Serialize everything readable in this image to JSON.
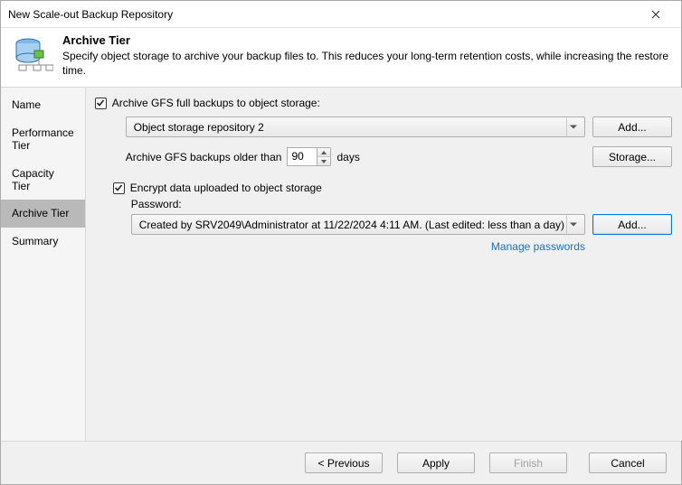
{
  "window": {
    "title": "New Scale-out Backup Repository"
  },
  "header": {
    "title": "Archive Tier",
    "subtitle": "Specify object storage to archive your backup files to. This reduces your long-term retention costs, while increasing the restore time."
  },
  "sidebar": {
    "items": [
      {
        "label": "Name"
      },
      {
        "label": "Performance Tier"
      },
      {
        "label": "Capacity Tier"
      },
      {
        "label": "Archive Tier"
      },
      {
        "label": "Summary"
      }
    ],
    "selected_index": 3
  },
  "content": {
    "archive_checkbox_label": "Archive GFS full backups to object storage:",
    "repository_select_value": "Object storage repository 2",
    "add_button_label": "Add...",
    "older_than_prefix": "Archive GFS backups older than",
    "older_than_days_value": "90",
    "older_than_suffix": "days",
    "storage_button_label": "Storage...",
    "encrypt_checkbox_label": "Encrypt data uploaded to object storage",
    "password_label": "Password:",
    "password_select_value": "Created by SRV2049\\Administrator at 11/22/2024 4:11 AM. (Last edited: less than a day)",
    "password_add_button_label": "Add...",
    "manage_passwords_link": "Manage passwords"
  },
  "footer": {
    "previous": "< Previous",
    "apply": "Apply",
    "finish": "Finish",
    "cancel": "Cancel"
  }
}
